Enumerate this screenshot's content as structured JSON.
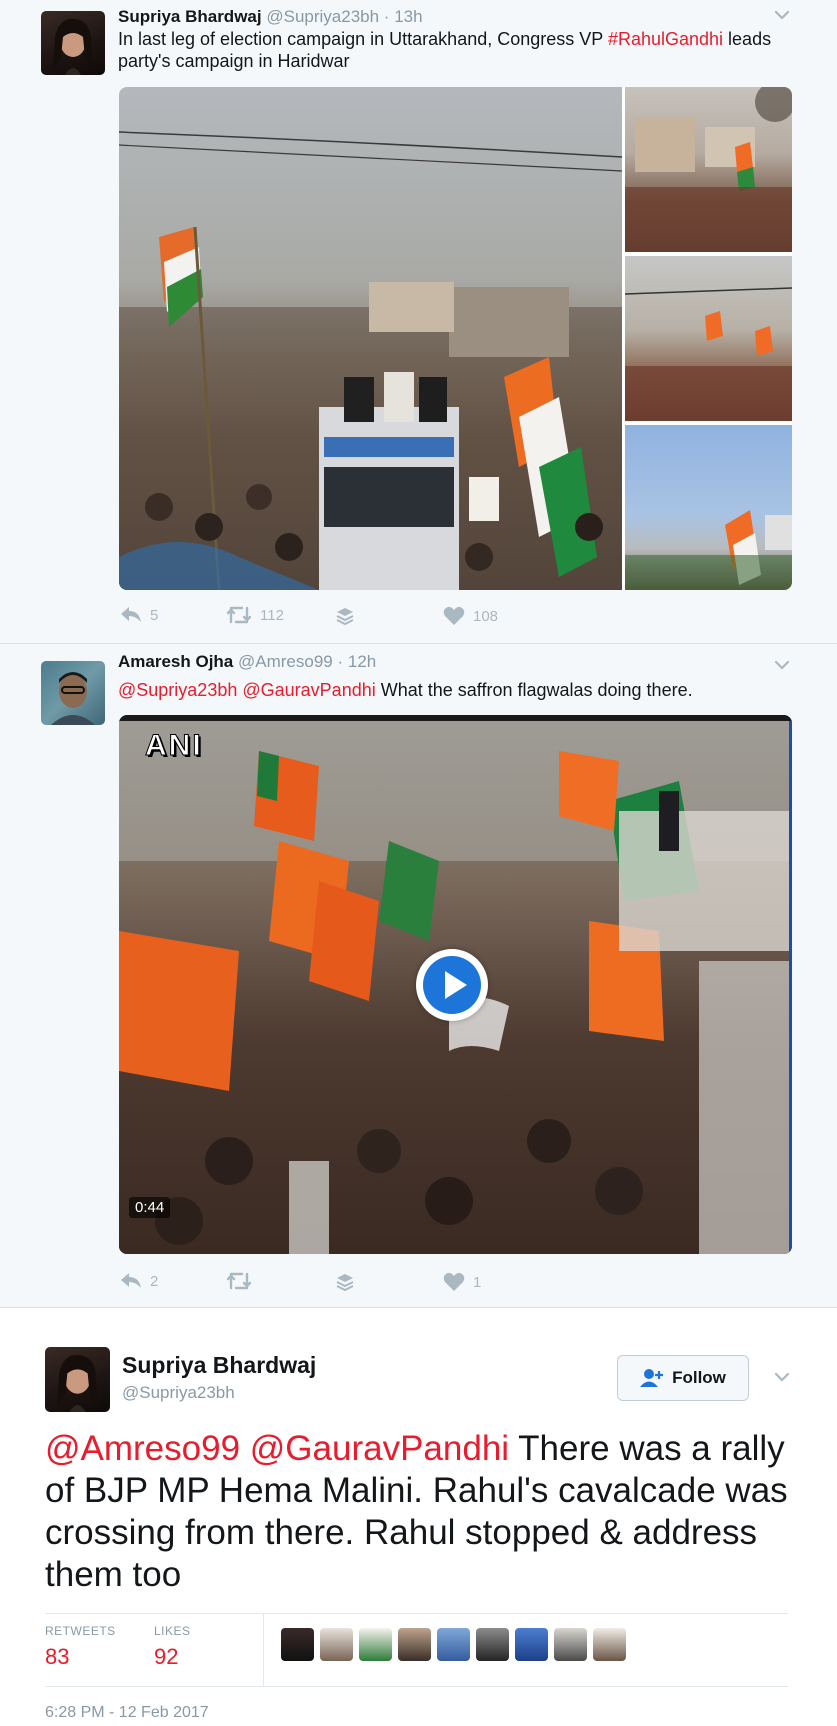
{
  "tweet1": {
    "name": "Supriya Bhardwaj",
    "handle": "@Supriya23bh",
    "dot": "·",
    "time": "13h",
    "text_line1_a": "In last leg of election campaign in Uttarakhand, Congress VP ",
    "hashtag": "#RahulGandhi",
    "text_line1_b": " leads",
    "text_line2": "party's campaign in Haridwar",
    "replies": "5",
    "retweets": "112",
    "likes": "108"
  },
  "tweet2": {
    "name": "Amaresh Ojha",
    "handle": "@Amreso99",
    "dot": "·",
    "time": "12h",
    "mention1": "@Supriya23bh",
    "mention2": "@GauravPandhi",
    "text": " What the saffron flagwalas doing there.",
    "video_watermark": "ANI",
    "video_duration": "0:44",
    "replies": "2",
    "likes": "1"
  },
  "tweet3": {
    "name": "Supriya Bhardwaj",
    "handle": "@Supriya23bh",
    "follow_label": "Follow",
    "mention1": "@Amreso99",
    "mention2": "@GauravPandhi",
    "text": " There was a rally of BJP MP Hema Malini. Rahul's cavalcade was crossing from there. Rahul stopped & address them too",
    "retweets_label": "RETWEETS",
    "retweets_value": "83",
    "likes_label": "LIKES",
    "likes_value": "92",
    "timestamp": "6:28 PM - 12 Feb 2017"
  },
  "icons": {
    "reply": "reply-icon",
    "retweet": "retweet-icon",
    "stack": "stack-icon",
    "like": "heart-icon",
    "chevron": "chevron-down-icon",
    "play": "play-icon",
    "follow": "add-user-icon"
  },
  "colors": {
    "link": "#e81c2c",
    "muted": "#8899a6",
    "action": "#aab8c2",
    "play_blue": "#1d74d9"
  }
}
